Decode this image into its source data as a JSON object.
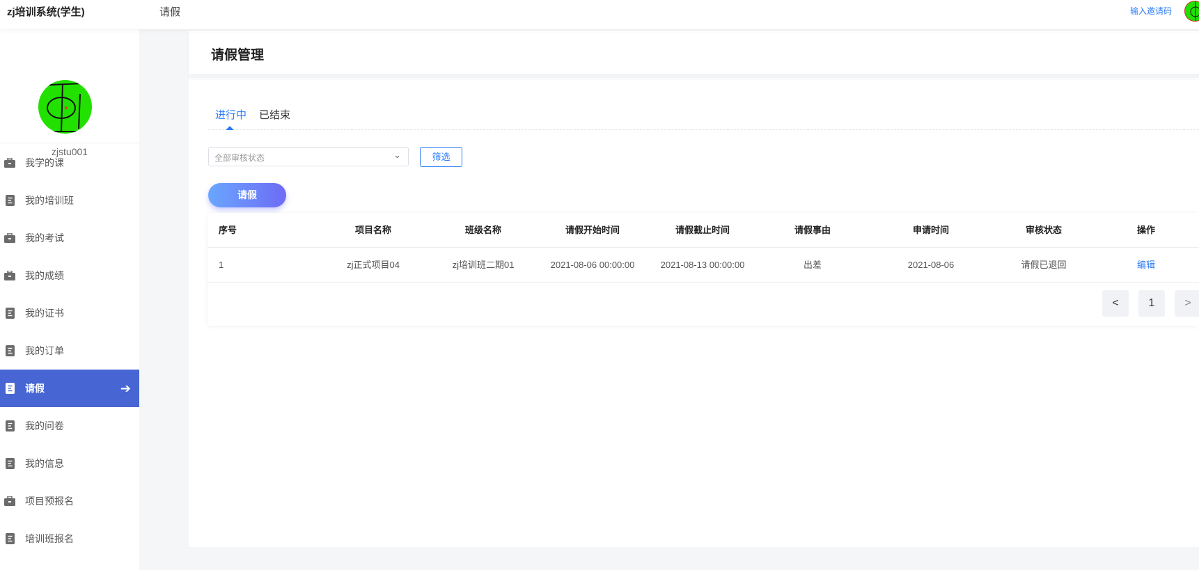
{
  "header": {
    "brand": "zj培训系统(学生)",
    "nav": "请假",
    "invite": "输入邀请码"
  },
  "sidebar": {
    "username": "zjstu001",
    "items": [
      {
        "label": "我学的课",
        "icon": "briefcase-icon"
      },
      {
        "label": "我的培训班",
        "icon": "document-icon"
      },
      {
        "label": "我的考试",
        "icon": "briefcase-icon"
      },
      {
        "label": "我的成绩",
        "icon": "briefcase-icon"
      },
      {
        "label": "我的证书",
        "icon": "document-icon"
      },
      {
        "label": "我的订单",
        "icon": "document-icon"
      },
      {
        "label": "请假",
        "icon": "document-icon",
        "active": true
      },
      {
        "label": "我的问卷",
        "icon": "document-icon"
      },
      {
        "label": "我的信息",
        "icon": "document-icon"
      },
      {
        "label": "项目预报名",
        "icon": "briefcase-icon"
      },
      {
        "label": "培训班报名",
        "icon": "document-icon"
      }
    ]
  },
  "main": {
    "title": "请假管理",
    "tabs": [
      "进行中",
      "已结束"
    ],
    "filter": {
      "placeholder": "全部审核状态",
      "button": "筛选"
    },
    "apply_button": "请假",
    "table": {
      "headers": [
        "序号",
        "项目名称",
        "班级名称",
        "请假开始时间",
        "请假截止时间",
        "请假事由",
        "申请时间",
        "审核状态",
        "操作"
      ],
      "rows": [
        [
          "1",
          "zj正式项目04",
          "zj培训班二期01",
          "2021-08-06 00:00:00",
          "2021-08-13 00:00:00",
          "出差",
          "2021-08-06",
          "请假已退回",
          "编辑"
        ]
      ]
    },
    "pagination": {
      "prev": "<",
      "page": "1",
      "next": ">"
    }
  }
}
